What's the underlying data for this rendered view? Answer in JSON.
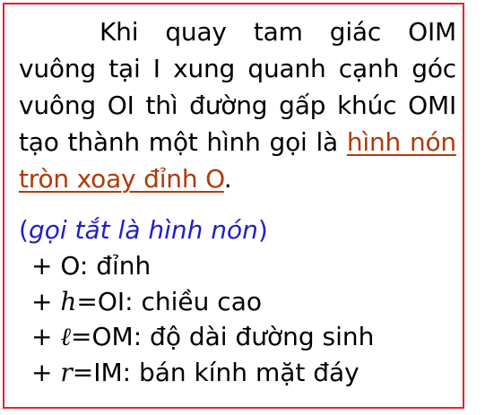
{
  "paragraph": {
    "text_before": "Khi quay tam giác OIM vuông tại I xung quanh cạnh góc vuông OI thì đường gấp khúc OMI tạo thành một hình gọi là ",
    "highlight": "hình nón tròn xoay đỉnh O",
    "text_after": "."
  },
  "note": {
    "open_paren": "(",
    "inner": "gọi tắt là hình nón",
    "close_paren": ")"
  },
  "items": [
    {
      "prefix": "+ O: ",
      "symbol": "",
      "text": "đỉnh"
    },
    {
      "prefix": "+ ",
      "symbol": "h",
      "text": "=OI: chiều cao"
    },
    {
      "prefix": "+ ",
      "symbol": "ℓ",
      "text": "=OM: độ dài đường sinh"
    },
    {
      "prefix": "+ ",
      "symbol": "r",
      "text": "=IM: bán kính mặt đáy"
    }
  ],
  "colors": {
    "border": "#e8212b",
    "highlight": "#b03a0a",
    "note": "#1f1fc8",
    "text": "#000000"
  }
}
